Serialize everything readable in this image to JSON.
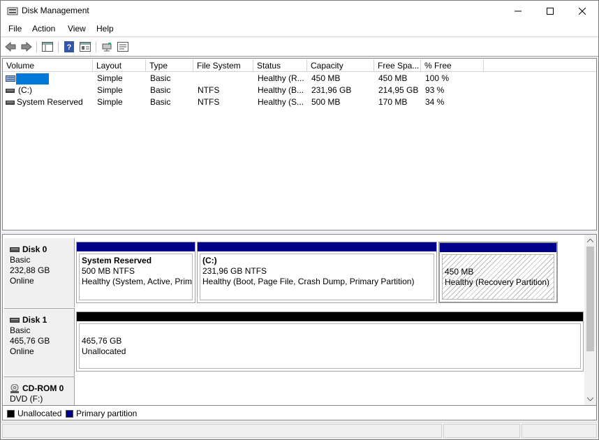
{
  "window": {
    "title": "Disk Management",
    "icons": {
      "app": "disk-management-icon",
      "minimize": "minimize-icon",
      "maximize": "maximize-icon",
      "close": "close-icon"
    }
  },
  "menu": {
    "items": [
      "File",
      "Action",
      "View",
      "Help"
    ]
  },
  "toolbar": {
    "buttons": [
      "back-icon",
      "forward-icon",
      "show-hide-console-tree-icon",
      "help-icon",
      "properties-icon",
      "connect-icon",
      "settings-icon"
    ]
  },
  "volume_list": {
    "columns": [
      "Volume",
      "Layout",
      "Type",
      "File System",
      "Status",
      "Capacity",
      "Free Spa...",
      "% Free"
    ],
    "rows": [
      {
        "volume": "",
        "layout": "Simple",
        "type": "Basic",
        "fs": "",
        "status": "Healthy (R...",
        "capacity": "450 MB",
        "free": "450 MB",
        "pct": "100 %",
        "selected": true
      },
      {
        "volume": "(C:)",
        "layout": "Simple",
        "type": "Basic",
        "fs": "NTFS",
        "status": "Healthy (B...",
        "capacity": "231,96 GB",
        "free": "214,95 GB",
        "pct": "93 %"
      },
      {
        "volume": "System Reserved",
        "layout": "Simple",
        "type": "Basic",
        "fs": "NTFS",
        "status": "Healthy (S...",
        "capacity": "500 MB",
        "free": "170 MB",
        "pct": "34 %"
      }
    ]
  },
  "disks": [
    {
      "name": "Disk 0",
      "type": "Basic",
      "size": "232,88 GB",
      "state": "Online",
      "partitions": [
        {
          "title": "System Reserved",
          "size": "500 MB NTFS",
          "status": "Healthy (System, Active, Prim",
          "color": "#00008b"
        },
        {
          "title": "(C:)",
          "size": "231,96 GB NTFS",
          "status": "Healthy (Boot, Page File, Crash Dump, Primary Partition)",
          "color": "#00008b"
        },
        {
          "title": "",
          "size": "450 MB",
          "status": "Healthy (Recovery Partition)",
          "color": "#00008b"
        }
      ]
    },
    {
      "name": "Disk 1",
      "type": "Basic",
      "size": "465,76 GB",
      "state": "Online",
      "partitions": [
        {
          "title": "",
          "size": "465,76 GB",
          "status": "Unallocated",
          "color": "#000000"
        }
      ]
    },
    {
      "name": "CD-ROM 0",
      "type": "DVD (F:)"
    }
  ],
  "legend": [
    {
      "label": "Unallocated",
      "color": "#000000"
    },
    {
      "label": "Primary partition",
      "color": "#00008b"
    }
  ],
  "colors": {
    "selection": "#0078d7",
    "primary": "#00008b",
    "unallocated": "#000000"
  }
}
